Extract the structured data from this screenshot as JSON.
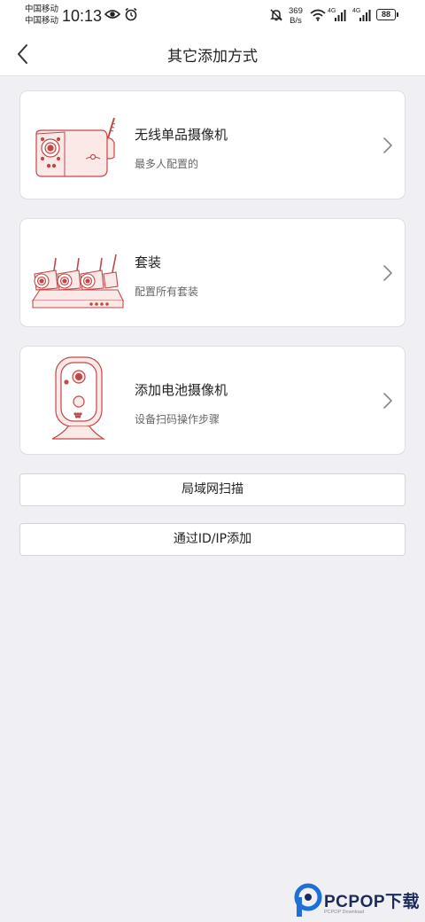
{
  "status_bar": {
    "carrier1": "中国移动",
    "carrier2": "中国移动",
    "time": "10:13",
    "net_speed_value": "369",
    "net_speed_unit": "B/s",
    "net1": "4G",
    "net2": "4G",
    "battery": "88"
  },
  "header": {
    "title": "其它添加方式"
  },
  "cards": [
    {
      "title": "无线单品摄像机",
      "subtitle": "最多人配置的"
    },
    {
      "title": "套装",
      "subtitle": "配置所有套装"
    },
    {
      "title": "添加电池摄像机",
      "subtitle": "设备扫码操作步骤"
    }
  ],
  "buttons": {
    "lan_scan": "局域网扫描",
    "add_by_id": "通过ID/IP添加"
  },
  "watermark": {
    "brand": "PCPOP下载",
    "sub": "PCPOP Download"
  },
  "colors": {
    "illustration_stroke": "#c24747",
    "illustration_fill": "#fbe9e8",
    "background": "#f0eff4"
  }
}
